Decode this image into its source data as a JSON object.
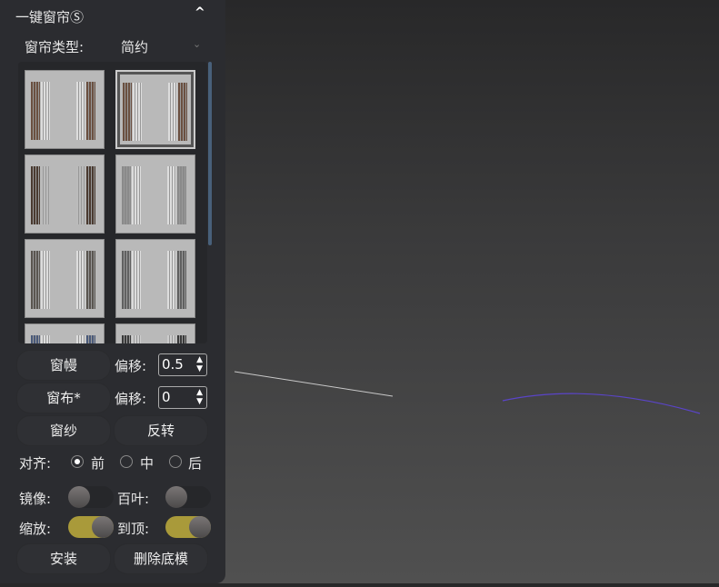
{
  "panel": {
    "title": "一键窗帘Ⓢ",
    "collapse_icon": "chevron-up-icon",
    "curtain_type": {
      "label": "窗帘类型:",
      "value": "简约"
    },
    "thumbnails": [
      {
        "colors": [
          "#6b5040",
          "#ddd"
        ],
        "selected": false
      },
      {
        "colors": [
          "#6b5040",
          "#ddd"
        ],
        "selected": true
      },
      {
        "colors": [
          "#4a3a30",
          "#bbb"
        ],
        "selected": false
      },
      {
        "colors": [
          "#8a8a8a",
          "#ddd"
        ],
        "selected": false
      },
      {
        "colors": [
          "#5a5550",
          "#ddd"
        ],
        "selected": false
      },
      {
        "colors": [
          "#606060",
          "#ddd"
        ],
        "selected": false
      },
      {
        "colors": [
          "#4a5a7a",
          "#ddd"
        ],
        "selected": false
      },
      {
        "colors": [
          "#3a3a3a",
          "#ccc"
        ],
        "selected": false
      }
    ],
    "valance_button": "窗幔",
    "cloth_button": "窗布*",
    "sheer_button": "窗纱",
    "flip_button": "反转",
    "offset1": {
      "label": "偏移:",
      "value": "0.5"
    },
    "offset2": {
      "label": "偏移:",
      "value": "0"
    },
    "align": {
      "label": "对齐:",
      "options": [
        "前",
        "中",
        "后"
      ],
      "selected": 0
    },
    "mirror": {
      "label": "镜像:",
      "on": false
    },
    "blinds": {
      "label": "百叶:",
      "on": false
    },
    "scale": {
      "label": "缩放:",
      "on": true
    },
    "to_top": {
      "label": "到顶:",
      "on": true
    },
    "install_button": "安装",
    "delete_base_button": "删除底模"
  },
  "colors": {
    "toggle_on": "#a99a3a",
    "accent_line": "#5a44c8"
  }
}
